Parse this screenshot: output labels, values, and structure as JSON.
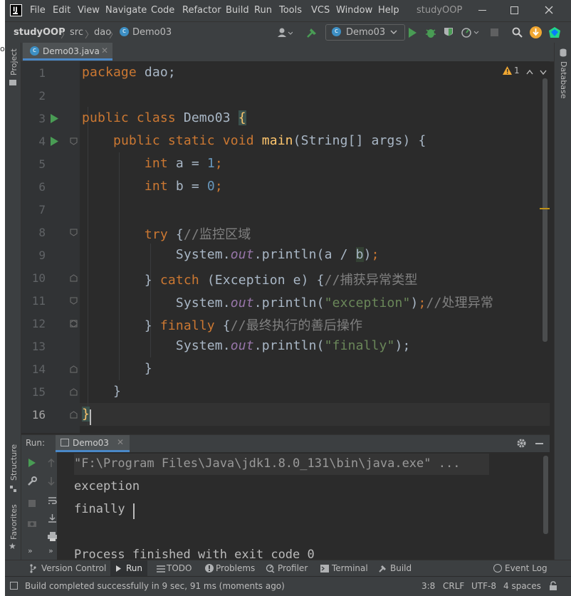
{
  "window": {
    "app_title": "studyOOP",
    "menu": [
      "File",
      "Edit",
      "View",
      "Navigate",
      "Code",
      "Refactor",
      "Build",
      "Run",
      "Tools",
      "VCS",
      "Window",
      "Help"
    ]
  },
  "navbar": {
    "breadcrumbs": [
      "studyOOP",
      "src",
      "dao",
      "Demo03"
    ],
    "run_config": "Demo03"
  },
  "editor": {
    "tab_label": "Demo03.java",
    "warning_count": "1",
    "line_numbers": [
      "1",
      "2",
      "3",
      "4",
      "5",
      "6",
      "7",
      "8",
      "9",
      "10",
      "11",
      "12",
      "13",
      "14",
      "15",
      "16"
    ],
    "code": {
      "l1_kw": "package",
      "l1_rest": " dao;",
      "l3_kw": "public class",
      "l3_name": " Demo03 ",
      "l3_brace": "{",
      "l4_kw": "public static void",
      "l4_fn": "main",
      "l4_rest": "(String[] args) {",
      "l5_kw": "int",
      "l5_mid": " a = ",
      "l5_num": "1",
      "l5_end": ";",
      "l6_kw": "int",
      "l6_mid": " b = ",
      "l6_num": "0",
      "l6_end": ";",
      "l8_kw": "try",
      "l8_brace": " {",
      "l8_cm": "//监控区域",
      "l9_a": "System.",
      "l9_out": "out",
      "l9_b": ".println(a / ",
      "l9_c": "b",
      "l9_d": ")",
      "l9_e": ";",
      "l10_a": "} ",
      "l10_kw": "catch",
      "l10_b": " (Exception e) {",
      "l10_cm": "//捕获异常类型",
      "l11_a": "System.",
      "l11_out": "out",
      "l11_b": ".println(",
      "l11_str": "\"exception\"",
      "l11_c": ")",
      "l11_d": ";",
      "l11_cm": "//处理异常",
      "l12_a": "} ",
      "l12_kw": "finally",
      "l12_b": " {",
      "l12_cm": "//最终执行的善后操作",
      "l13_a": "System.",
      "l13_out": "out",
      "l13_b": ".println(",
      "l13_str": "\"finally\"",
      "l13_c": ");",
      "l14": "}",
      "l15": "}",
      "l16": "}"
    }
  },
  "left_strip": {
    "project": "Project",
    "structure": "Structure",
    "favorites": "Favorites"
  },
  "right_strip": {
    "database": "Database"
  },
  "run_panel": {
    "label": "Run:",
    "tab": "Demo03",
    "console_lines": [
      "\"F:\\Program Files\\Java\\jdk1.8.0_131\\bin\\java.exe\" ...",
      "exception",
      "finally",
      "",
      "Process finished with exit code 0"
    ]
  },
  "bottom_tabs": {
    "version_control": "Version Control",
    "run": "Run",
    "todo": "TODO",
    "problems": "Problems",
    "profiler": "Profiler",
    "terminal": "Terminal",
    "build": "Build",
    "event_log": "Event Log"
  },
  "status_bar": {
    "message": "Build completed successfully in 9 sec, 91 ms (moments ago)",
    "position": "3:8",
    "line_sep": "CRLF",
    "encoding": "UTF-8",
    "indent": "4 spaces"
  },
  "colors": {
    "accent_green": "#499c54",
    "keyword": "#cc7832",
    "function": "#ffc66d",
    "number": "#6897bb",
    "string": "#6a8759",
    "static_field": "#9876aa",
    "comment": "#808080",
    "warning": "#f0a732"
  }
}
